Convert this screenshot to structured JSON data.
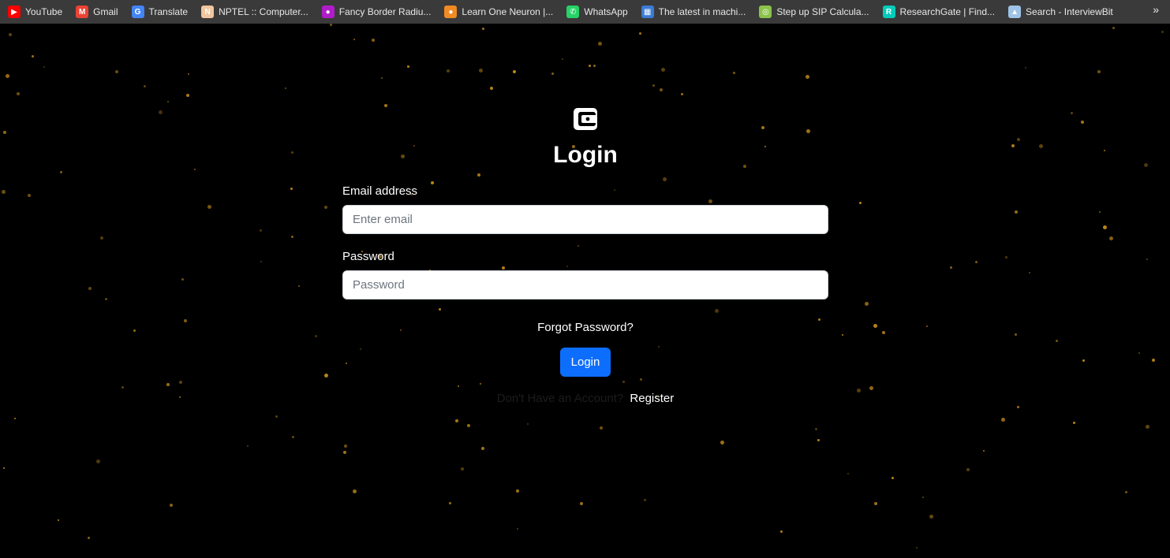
{
  "bookmarks": [
    {
      "label": "YouTube",
      "icon": "youtube-icon",
      "color": "#ff0000",
      "glyph": "▶"
    },
    {
      "label": "Gmail",
      "icon": "gmail-icon",
      "color": "#ea4335",
      "glyph": "M"
    },
    {
      "label": "Translate",
      "icon": "translate-icon",
      "color": "#4285f4",
      "glyph": "G"
    },
    {
      "label": "NPTEL :: Computer...",
      "icon": "nptel-icon",
      "color": "#f2c6a0",
      "glyph": "N"
    },
    {
      "label": "Fancy Border Radiu...",
      "icon": "fancy-border-icon",
      "color": "#b01cc9",
      "glyph": "●"
    },
    {
      "label": "Learn One Neuron |...",
      "icon": "one-neuron-icon",
      "color": "#f08a24",
      "glyph": "●"
    },
    {
      "label": "WhatsApp",
      "icon": "whatsapp-icon",
      "color": "#25d366",
      "glyph": "✆"
    },
    {
      "label": "The latest in machi...",
      "icon": "papers-icon",
      "color": "#3a7bd5",
      "glyph": "▦"
    },
    {
      "label": "Step up SIP Calcula...",
      "icon": "sip-calc-icon",
      "color": "#8bc34a",
      "glyph": "◎"
    },
    {
      "label": "ResearchGate | Find...",
      "icon": "researchgate-icon",
      "color": "#00ccbb",
      "glyph": "R"
    },
    {
      "label": "Search - InterviewBit",
      "icon": "interviewbit-icon",
      "color": "#9ec3e6",
      "glyph": "▲"
    }
  ],
  "bookmarks_overflow": "»",
  "login": {
    "title": "Login",
    "email_label": "Email address",
    "email_placeholder": "Enter email",
    "email_value": "",
    "password_label": "Password",
    "password_placeholder": "Password",
    "password_value": "",
    "forgot_label": "Forgot Password?",
    "button_label": "Login",
    "register_prompt": "Don't Have an Account?",
    "register_label": "Register"
  },
  "colors": {
    "background": "#000000",
    "accent": "#0d6efd",
    "star": "#c8901a",
    "bookmarks_bar": "#3a3a3a"
  }
}
